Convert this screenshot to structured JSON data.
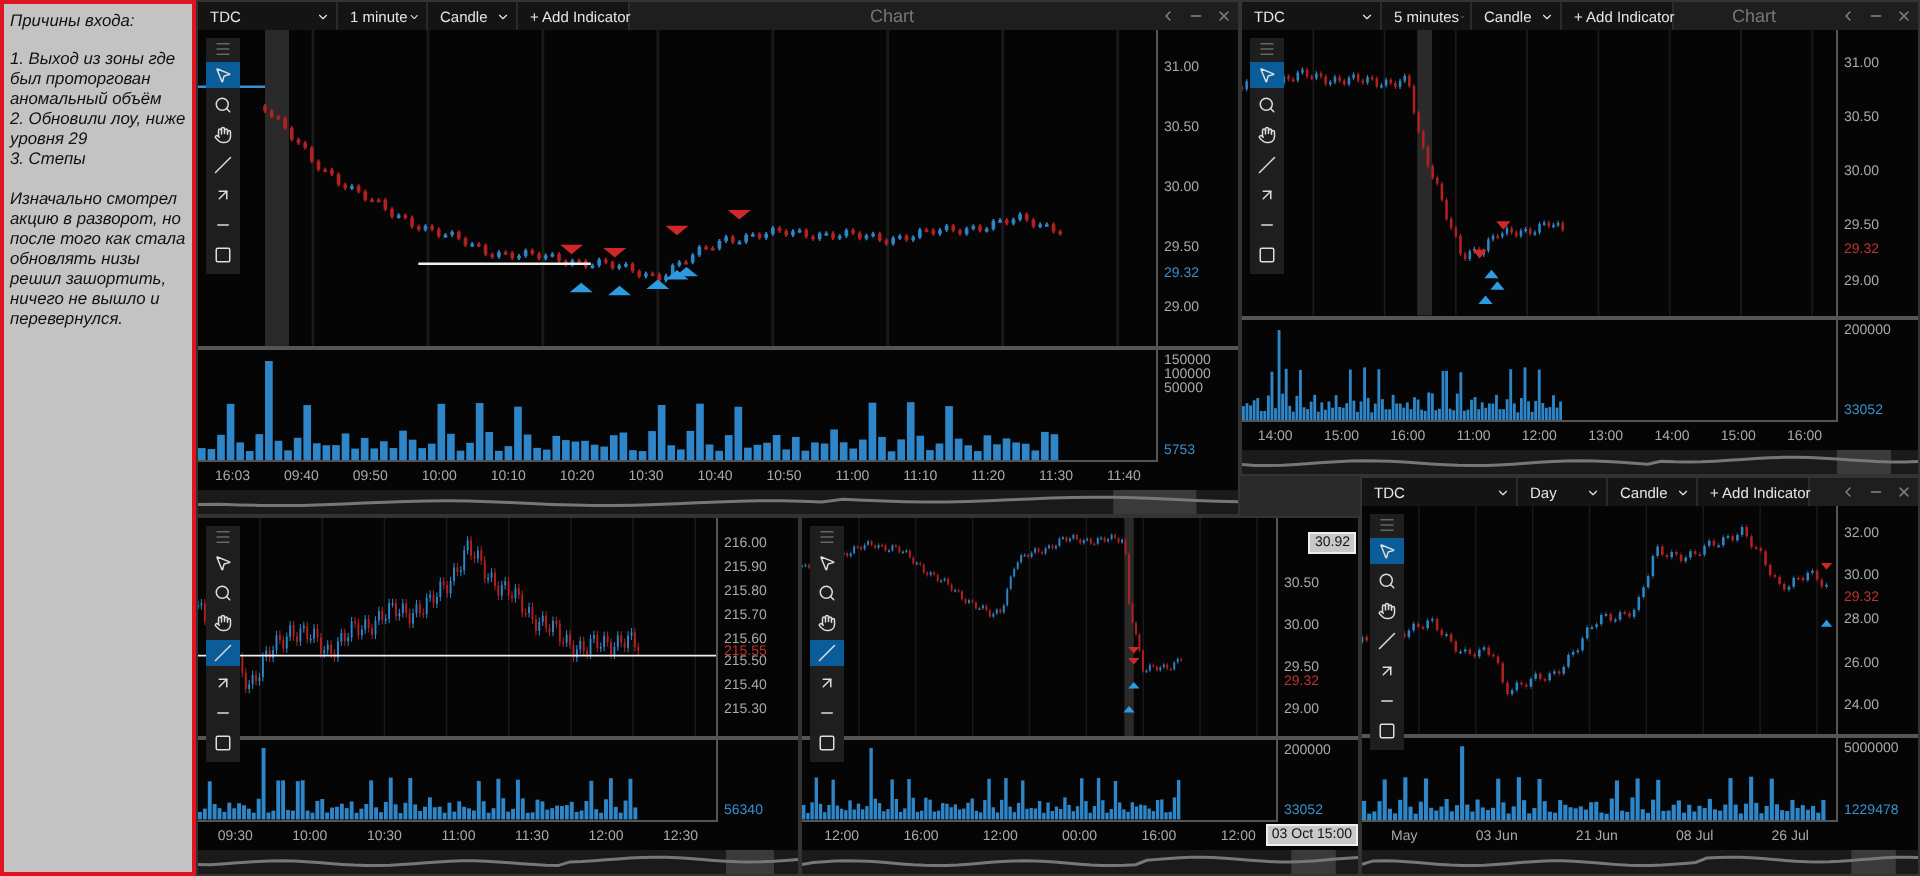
{
  "notes": {
    "title": "Причины входа:",
    "items": [
      "1. Выход из зоны где был проторгован аномальный объём",
      "2. Обновили лоу, ниже уровня 29",
      "3. Степы"
    ],
    "comment": "Изначально смотрел акцию в разворот, но после того как стала обновлять низы решил зашортить, ничего не вышло и перевернулся."
  },
  "charts": [
    {
      "header": {
        "symbol": "TDC",
        "interval": "1 minute",
        "style": "Candle",
        "indicator": "+ Add Indicator",
        "title": "Chart"
      },
      "tools": [
        {
          "kind": "pointer",
          "selected": true
        },
        {
          "kind": "zoom",
          "selected": false
        },
        {
          "kind": "hand",
          "selected": false
        },
        {
          "kind": "line",
          "selected": false
        },
        {
          "kind": "arrow",
          "selected": false
        },
        {
          "kind": "hline",
          "selected": false
        },
        {
          "kind": "rect",
          "selected": false
        }
      ],
      "price_ticks": [
        "31.00",
        "30.50",
        "30.00",
        "29.50",
        "29.00"
      ],
      "last_price": {
        "text": "29.32",
        "color": "#3a8fd0"
      },
      "volume_ticks": [
        "150000",
        "100000",
        "50000"
      ],
      "last_volume": "5753",
      "time_ticks": [
        "16:03",
        "09:40",
        "09:50",
        "10:00",
        "10:10",
        "10:20",
        "10:30",
        "10:40",
        "10:50",
        "11:00",
        "11:10",
        "11:20",
        "11:30",
        "11:40"
      ]
    },
    {
      "header": {
        "symbol": "TDC",
        "interval": "5 minutes",
        "style": "Candle",
        "indicator": "+ Add Indicator",
        "title": "Chart"
      },
      "tools": [
        {
          "kind": "pointer",
          "selected": true
        },
        {
          "kind": "zoom",
          "selected": false
        },
        {
          "kind": "hand",
          "selected": false
        },
        {
          "kind": "line",
          "selected": false
        },
        {
          "kind": "arrow",
          "selected": false
        },
        {
          "kind": "hline",
          "selected": false
        },
        {
          "kind": "rect",
          "selected": false
        }
      ],
      "price_ticks": [
        "31.00",
        "30.50",
        "30.00",
        "29.50",
        "29.00"
      ],
      "last_price": {
        "text": "29.32",
        "color": "#c03030"
      },
      "volume_ticks": [
        "200000"
      ],
      "last_volume": "33052",
      "time_ticks": [
        "14:00",
        "15:00",
        "16:00",
        "11:00",
        "12:00",
        "13:00",
        "14:00",
        "15:00",
        "16:00"
      ]
    },
    {
      "tools": [
        {
          "kind": "pointer",
          "selected": false
        },
        {
          "kind": "zoom",
          "selected": false
        },
        {
          "kind": "hand",
          "selected": false
        },
        {
          "kind": "line",
          "selected": true
        },
        {
          "kind": "arrow",
          "selected": false
        },
        {
          "kind": "hline",
          "selected": false
        },
        {
          "kind": "rect",
          "selected": false
        }
      ],
      "price_ticks": [
        "216.00",
        "215.90",
        "215.80",
        "215.70",
        "215.60",
        "215.50",
        "215.40",
        "215.30"
      ],
      "last_price": {
        "text": "215.55",
        "color": "#c03030"
      },
      "last_volume": "56340",
      "time_ticks": [
        "09:30",
        "10:00",
        "10:30",
        "11:00",
        "11:30",
        "12:00",
        "12:30"
      ]
    },
    {
      "tools": [
        {
          "kind": "pointer",
          "selected": false
        },
        {
          "kind": "zoom",
          "selected": false
        },
        {
          "kind": "hand",
          "selected": false
        },
        {
          "kind": "line",
          "selected": true
        },
        {
          "kind": "arrow",
          "selected": false
        },
        {
          "kind": "hline",
          "selected": false
        },
        {
          "kind": "rect",
          "selected": false
        }
      ],
      "price_ticks": [
        "30.50",
        "30.00",
        "29.50",
        "29.00"
      ],
      "last_price": {
        "text": "29.32",
        "color": "#c03030"
      },
      "crosshair": {
        "price": "30.92",
        "time": "03 Oct 15:00"
      },
      "volume_ticks": [
        "200000"
      ],
      "last_volume": "33052",
      "time_ticks": [
        "12:00",
        "16:00",
        "12:00",
        "00:00",
        "16:00",
        "12:00"
      ]
    },
    {
      "header": {
        "symbol": "TDC",
        "interval": "Day",
        "style": "Candle",
        "indicator": "+ Add Indicator"
      },
      "tools": [
        {
          "kind": "pointer",
          "selected": true
        },
        {
          "kind": "zoom",
          "selected": false
        },
        {
          "kind": "hand",
          "selected": false
        },
        {
          "kind": "line",
          "selected": false
        },
        {
          "kind": "arrow",
          "selected": false
        },
        {
          "kind": "hline",
          "selected": false
        },
        {
          "kind": "rect",
          "selected": false
        }
      ],
      "price_ticks": [
        "32.00",
        "30.00",
        "28.00",
        "26.00",
        "24.00"
      ],
      "last_price": {
        "text": "29.32",
        "color": "#c03030"
      },
      "volume_ticks": [
        "5000000"
      ],
      "last_volume": "1229478",
      "time_ticks": [
        "May",
        "03 Jun",
        "21 Jun",
        "08 Jul",
        "26 Jul"
      ]
    }
  ]
}
